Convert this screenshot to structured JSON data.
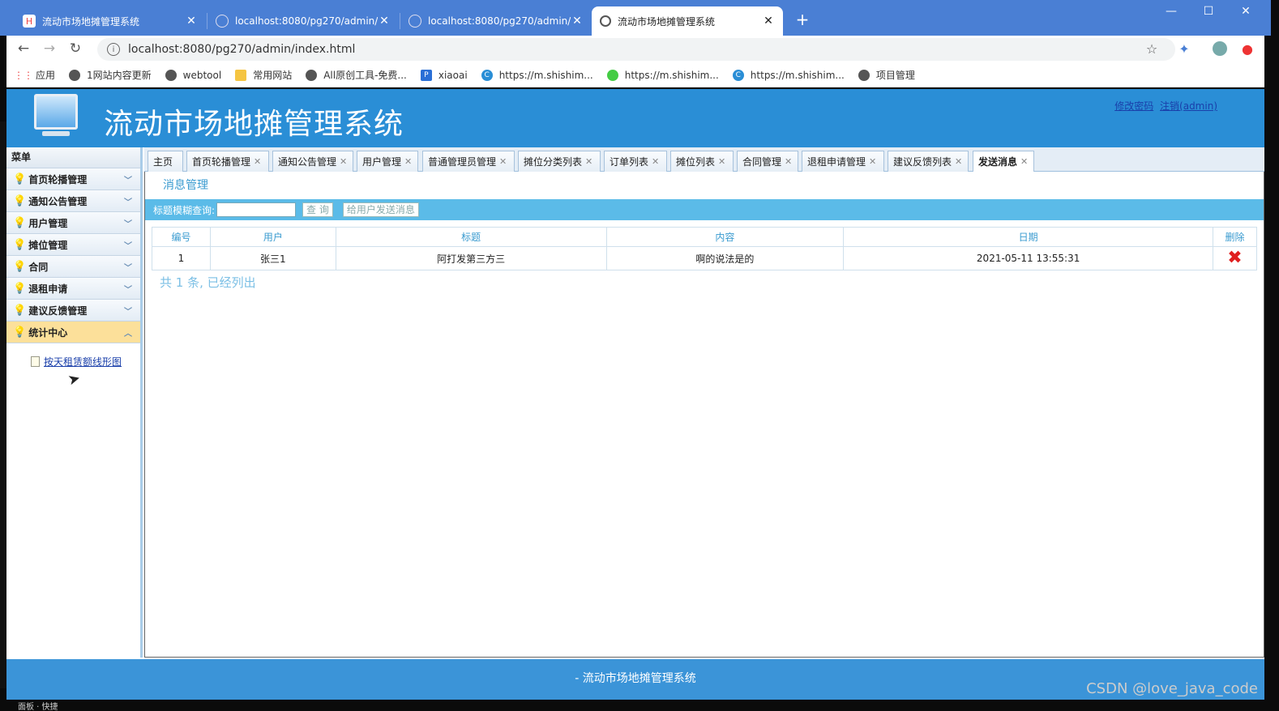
{
  "browser": {
    "tabs": [
      {
        "title": "流动市场地摊管理系统",
        "active": false
      },
      {
        "title": "localhost:8080/pg270/admin/",
        "active": false
      },
      {
        "title": "localhost:8080/pg270/admin/",
        "active": false
      },
      {
        "title": "流动市场地摊管理系统",
        "active": true
      }
    ],
    "url": "localhost:8080/pg270/admin/index.html",
    "bookmarks": [
      "应用",
      "1网站内容更新",
      "webtool",
      "常用网站",
      "All原创工具-免费...",
      "xiaoai",
      "https://m.shishim...",
      "https://m.shishim...",
      "https://m.shishim...",
      "项目管理"
    ]
  },
  "header": {
    "title": "流动市场地摊管理系统",
    "change_password": "修改密码",
    "logout": "注销(admin)"
  },
  "sidebar": {
    "heading": "菜单",
    "items": [
      {
        "label": "首页轮播管理"
      },
      {
        "label": "通知公告管理"
      },
      {
        "label": "用户管理"
      },
      {
        "label": "摊位管理"
      },
      {
        "label": "合同"
      },
      {
        "label": "退租申请"
      },
      {
        "label": "建议反馈管理"
      },
      {
        "label": "统计中心"
      }
    ],
    "sub_link": "按天租赁额线形图"
  },
  "page_tabs": [
    "主页",
    "首页轮播管理",
    "通知公告管理",
    "用户管理",
    "普通管理员管理",
    "摊位分类列表",
    "订单列表",
    "摊位列表",
    "合同管理",
    "退租申请管理",
    "建议反馈列表",
    "发送消息"
  ],
  "panel": {
    "title": "消息管理",
    "search_label": "标题模糊查询:",
    "search_value": "",
    "query_button": "查 询",
    "send_button": "给用户发送消息"
  },
  "table": {
    "headers": [
      "编号",
      "用户",
      "标题",
      "内容",
      "日期",
      "删除"
    ],
    "rows": [
      {
        "id": "1",
        "user": "张三1",
        "title": "阿打发第三方三",
        "content": "啊的说法是的",
        "date": "2021-05-11 13:55:31"
      }
    ],
    "count_text": "共 1 条, 已经列出"
  },
  "footer": {
    "text": "- 流动市场地摊管理系统"
  },
  "watermark": "CSDN @love_java_code",
  "taskbar_text": "面板 · 快捷"
}
